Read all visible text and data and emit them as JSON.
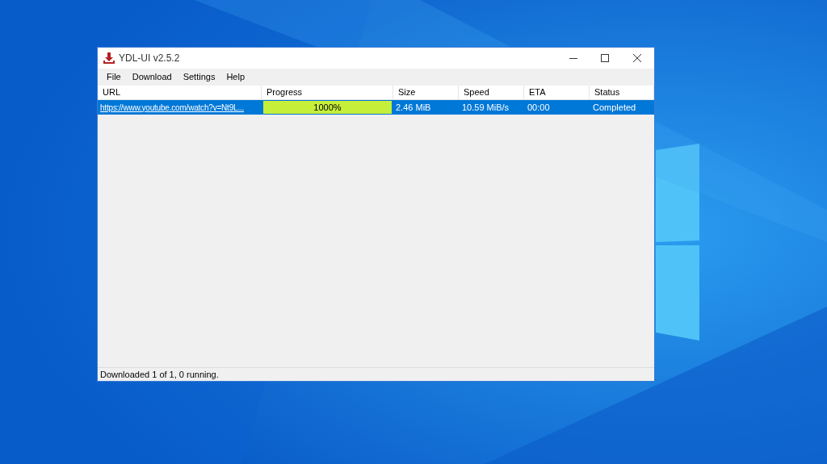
{
  "window": {
    "title": "YDL-UI v2.5.2"
  },
  "menu": [
    "File",
    "Download",
    "Settings",
    "Help"
  ],
  "table": {
    "columns": [
      "URL",
      "Progress",
      "Size",
      "Speed",
      "ETA",
      "Status"
    ],
    "rows": [
      {
        "selected": true,
        "url": "https://www.youtube.com/watch?v=Nt9L...",
        "progress": {
          "level": 1,
          "reading": "1000%"
        },
        "size": "2.46 MiB",
        "speed": "10.59 MiB/s",
        "eta": "00:00",
        "status": "Completed"
      }
    ]
  },
  "status_bar": "Downloaded 1 of 1, 0 running."
}
